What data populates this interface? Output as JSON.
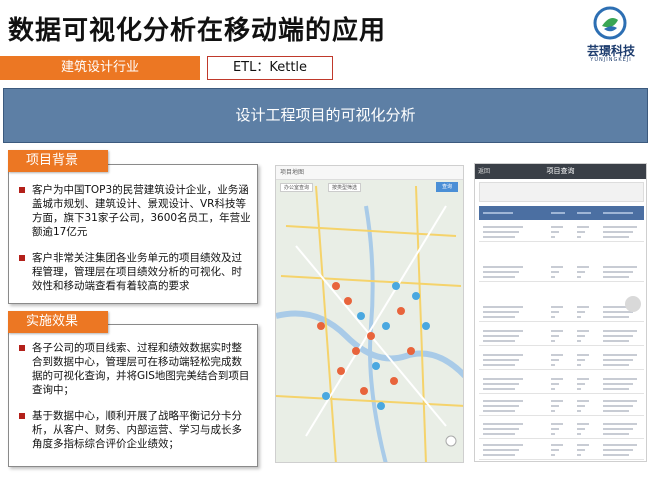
{
  "header": {
    "title": "数据可视化分析在移动端的应用",
    "logo_name": "芸璟科技",
    "logo_sub": "YUNJINGKEJI"
  },
  "tags": {
    "industry": "建筑设计行业",
    "etl": "ETL：Kettle"
  },
  "banner": {
    "text": "设计工程项目的可视化分析"
  },
  "background_section": {
    "label": "项目背景",
    "bullets": [
      "客户为中国TOP3的民营建筑设计企业，业务涵盖城市规划、建筑设计、景观设计、VR科技等方面，旗下31家子公司，3600名员工，年营业额逾17亿元",
      "客户非常关注集团各业务单元的项目绩效及过程管理，管理层在项目绩效分析的可视化、时效性和移动端查看有着较高的要求"
    ]
  },
  "result_section": {
    "label": "实施效果",
    "bullets": [
      "各子公司的项目线索、过程和绩效数据实时整合到数据中心，管理层可在移动端轻松完成数据的可视化查询，并将GIS地图完美结合到项目查询中；",
      "基于数据中心，顺利开展了战略平衡记分卡分析，从客户、财务、内部运营、学习与成长多角度多指标综合评价企业绩效；"
    ]
  },
  "map_screen": {
    "header": "项目地图",
    "filter_1": "办公室查询",
    "filter_2": "按类型筛选",
    "search_button": "查询"
  },
  "table_screen": {
    "back": "返回",
    "title": "项目查询"
  },
  "colors": {
    "accent_orange": "#ec7723",
    "banner_blue": "#5d7fa5",
    "bullet_red": "#b3201a"
  }
}
